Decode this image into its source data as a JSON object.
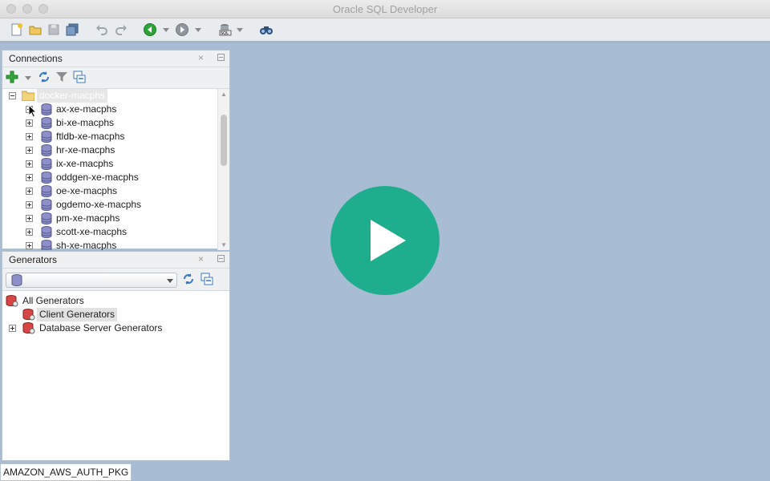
{
  "window": {
    "title": "Oracle SQL Developer"
  },
  "toolbar": {
    "buttons": [
      "new-icon",
      "open-icon",
      "save-icon",
      "save-all-icon",
      "undo-icon",
      "redo-icon",
      "back-icon",
      "forward-icon",
      "sql-worksheet-icon",
      "find-db-object-icon"
    ]
  },
  "connections": {
    "title": "Connections",
    "close_glyph": "×",
    "root": "docker-macphs",
    "items": [
      "ax-xe-macphs",
      "bi-xe-macphs",
      "ftldb-xe-macphs",
      "hr-xe-macphs",
      "ix-xe-macphs",
      "oddgen-xe-macphs",
      "oe-xe-macphs",
      "ogdemo-xe-macphs",
      "pm-xe-macphs",
      "scott-xe-macphs",
      "sh-xe-macphs"
    ]
  },
  "generators": {
    "title": "Generators",
    "close_glyph": "×",
    "combo_value": "",
    "tree": {
      "root": "All Generators",
      "children": [
        "Client Generators",
        "Database Server Generators"
      ]
    }
  },
  "status": {
    "text": "AMAZON_AWS_AUTH_PKG"
  },
  "colors": {
    "accent": "#1fae8d",
    "background": "#a8bdd4",
    "selection": "#e2e2e2"
  }
}
